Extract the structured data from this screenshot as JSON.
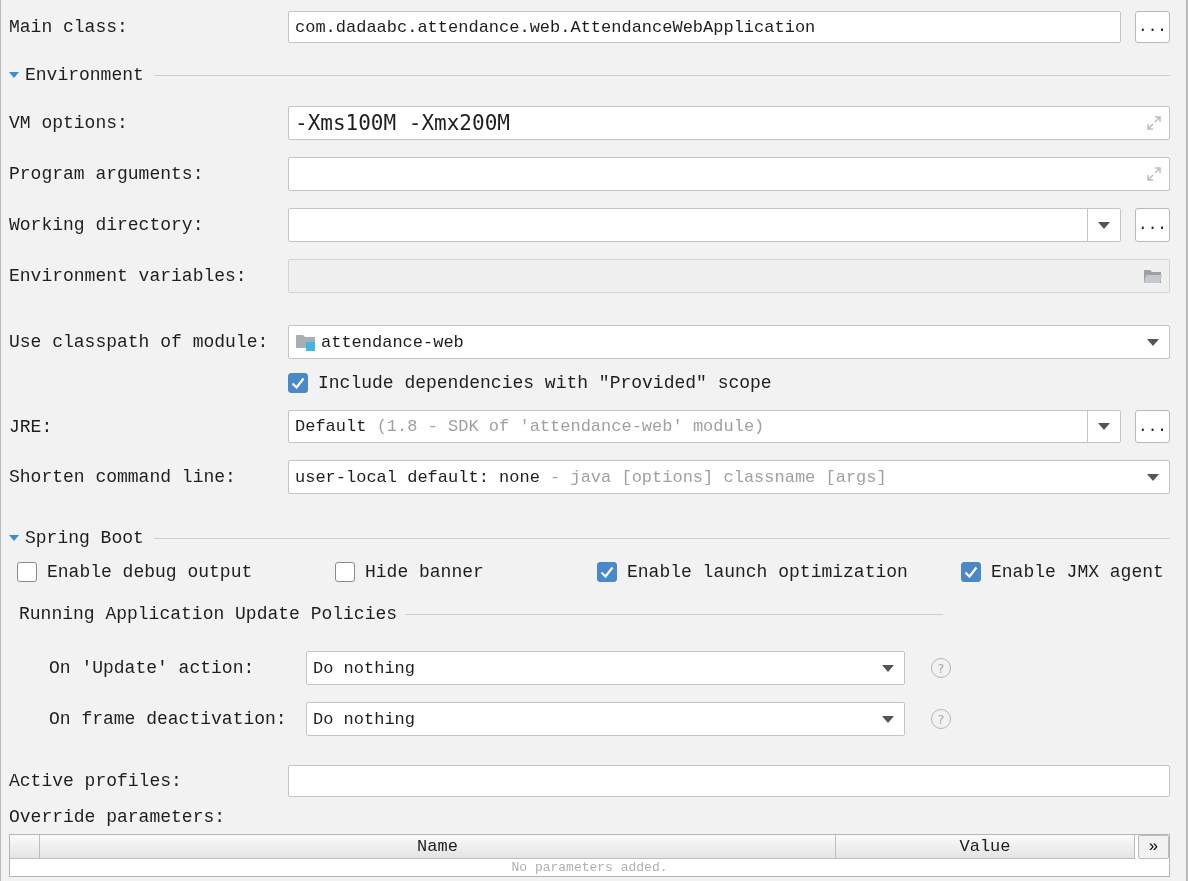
{
  "main_class": {
    "label": "Main class:",
    "value": "com.dadaabc.attendance.web.AttendanceWebApplication",
    "browse": "..."
  },
  "environment": {
    "title": "Environment",
    "expanded": true,
    "fields": [
      {
        "kind": "expand",
        "label": "VM options:",
        "value": "-Xms100M -Xmx200M"
      },
      {
        "kind": "expand",
        "label": "Program arguments:"
      },
      {
        "kind": "combo_browse",
        "label": "Working directory:",
        "browse": "..."
      },
      {
        "kind": "folder",
        "label": "Environment variables:",
        "disabled": true
      }
    ],
    "classpath": {
      "label": "Use classpath of module:",
      "value": "attendance-web"
    },
    "include_provided": {
      "label": "Include dependencies with \"Provided\" scope",
      "checked": true
    },
    "jre": {
      "label": "JRE:",
      "value": "Default",
      "hint": "(1.8 - SDK of 'attendance-web' module)",
      "browse": "..."
    },
    "shorten": {
      "label": "Shorten command line:",
      "value": "user-local default: none",
      "hint": "- java [options] classname [args]"
    }
  },
  "spring_boot": {
    "title": "Spring Boot",
    "expanded": true,
    "options": [
      {
        "label": "Enable debug output",
        "checked": false
      },
      {
        "label": "Hide banner",
        "checked": false
      },
      {
        "label": "Enable launch optimization",
        "checked": true
      },
      {
        "label": "Enable JMX agent",
        "checked": true
      }
    ],
    "policies": {
      "title": "Running Application Update Policies",
      "rows": [
        {
          "label": "On 'Update' action:",
          "value": "Do nothing",
          "help": "?"
        },
        {
          "label": "On frame deactivation:",
          "value": "Do nothing",
          "help": "?"
        }
      ]
    },
    "active_profiles": {
      "label": "Active profiles:"
    },
    "override": {
      "label": "Override parameters:",
      "columns": [
        "Name",
        "Value"
      ],
      "empty_text": "No parameters added.",
      "more": "»"
    }
  }
}
